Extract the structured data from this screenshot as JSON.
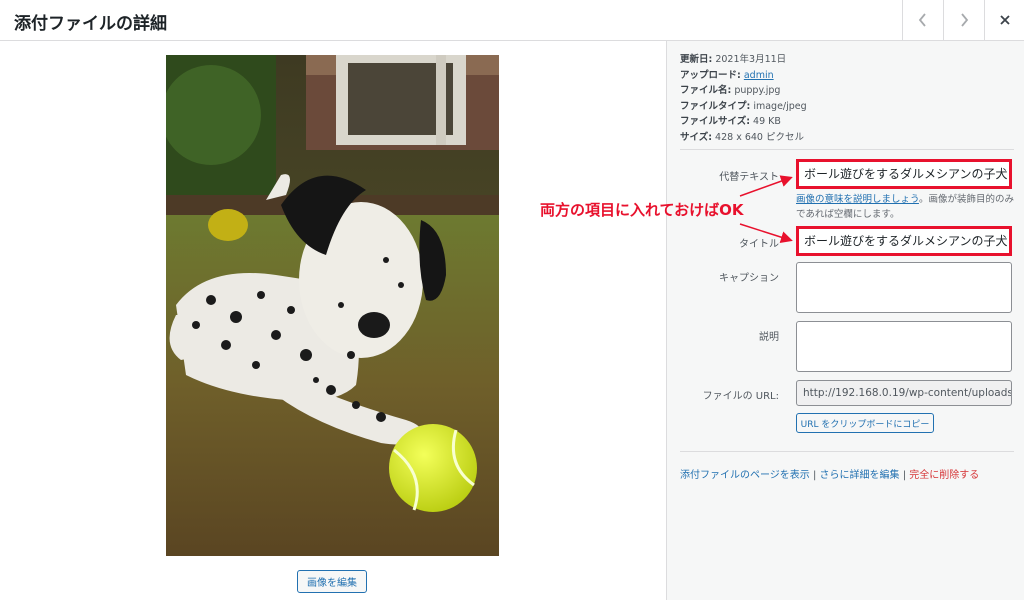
{
  "header": {
    "title": "添付ファイルの詳細"
  },
  "meta": {
    "updated_label": "更新日:",
    "updated_value": "2021年3月11日",
    "uploaded_label": "アップロード:",
    "uploaded_value": "admin",
    "filename_label": "ファイル名:",
    "filename_value": "puppy.jpg",
    "filetype_label": "ファイルタイプ:",
    "filetype_value": "image/jpeg",
    "filesize_label": "ファイルサイズ:",
    "filesize_value": "49 KB",
    "dimensions_label": "サイズ:",
    "dimensions_value": "428 x 640 ピクセル"
  },
  "fields": {
    "alt_label": "代替テキスト",
    "alt_value": "ボール遊びをするダルメシアンの子犬",
    "alt_help_link": "画像の意味を説明しましょう",
    "alt_help_text": "。画像が装飾目的のみであれば空欄にします。",
    "title_label": "タイトル",
    "title_value": "ボール遊びをするダルメシアンの子犬",
    "caption_label": "キャプション",
    "description_label": "説明",
    "url_label": "ファイルの URL:",
    "url_value": "http://192.168.0.19/wp-content/uploads/",
    "copy_button": "URL をクリップボードにコピー"
  },
  "actions": {
    "view_page": "添付ファイルのページを表示",
    "edit_more": "さらに詳細を編集",
    "delete": "完全に削除する",
    "separator": " | "
  },
  "image": {
    "edit_button": "画像を編集"
  },
  "annotation": {
    "text": "両方の項目に入れておけばOK",
    "color": "#e8112d"
  },
  "icons": {
    "prev": "chevron-left-icon",
    "next": "chevron-right-icon",
    "close": "close-icon"
  },
  "colors": {
    "link": "#2271b1",
    "delete": "#d63638",
    "highlight": "#e8112d"
  }
}
